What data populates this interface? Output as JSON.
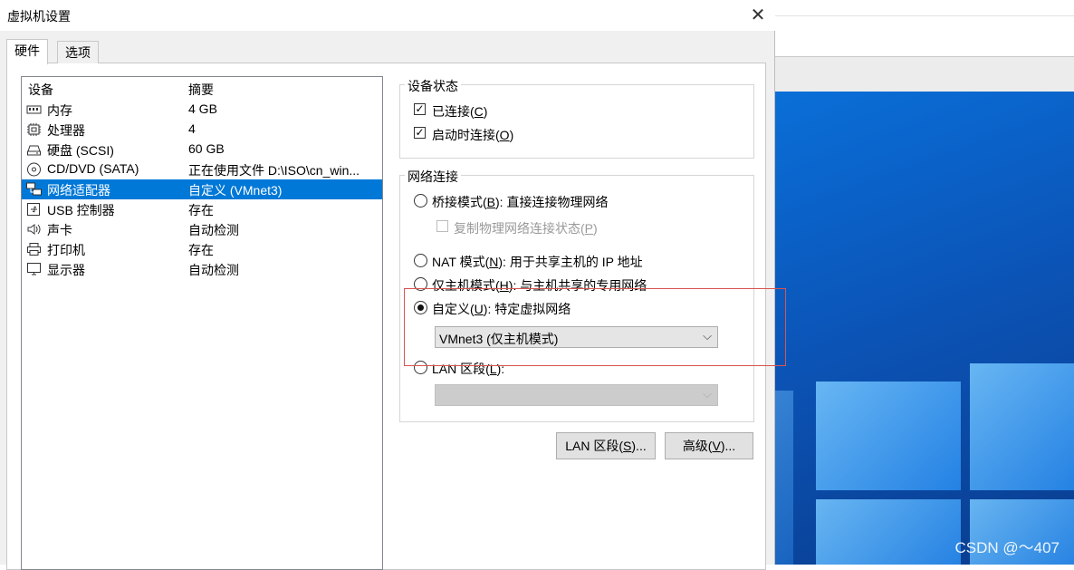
{
  "window": {
    "title": "虚拟机设置",
    "close": "✕"
  },
  "tabs": [
    {
      "label": "硬件"
    },
    {
      "label": "选项"
    }
  ],
  "device_list": {
    "columns": [
      "设备",
      "摘要"
    ],
    "rows": [
      {
        "name": "内存",
        "summary": "4 GB",
        "icon": "memory-icon"
      },
      {
        "name": "处理器",
        "summary": "4",
        "icon": "cpu-icon"
      },
      {
        "name": "硬盘 (SCSI)",
        "summary": "60 GB",
        "icon": "hard-disk-icon"
      },
      {
        "name": "CD/DVD (SATA)",
        "summary": "正在使用文件 D:\\ISO\\cn_win...",
        "icon": "cd-dvd-icon"
      },
      {
        "name": "网络适配器",
        "summary": "自定义 (VMnet3)",
        "icon": "network-adapter-icon",
        "selected": true
      },
      {
        "name": "USB 控制器",
        "summary": "存在",
        "icon": "usb-icon"
      },
      {
        "name": "声卡",
        "summary": "自动检测",
        "icon": "speaker-icon"
      },
      {
        "name": "打印机",
        "summary": "存在",
        "icon": "printer-icon"
      },
      {
        "name": "显示器",
        "summary": "自动检测",
        "icon": "monitor-icon"
      }
    ]
  },
  "device_status": {
    "title": "设备状态",
    "connected": {
      "text": "已连接(",
      "key": "C",
      "end": ")",
      "checked": true
    },
    "connect_on_start": {
      "text": "启动时连接(",
      "key": "O",
      "end": ")",
      "checked": true
    }
  },
  "network": {
    "title": "网络连接",
    "bridged": {
      "text": "桥接模式(",
      "key": "B",
      "end": "): 直接连接物理网络"
    },
    "replicate": {
      "text": "复制物理网络连接状态(",
      "key": "P",
      "end": ")"
    },
    "nat": {
      "text": "NAT 模式(",
      "key": "N",
      "end": "): 用于共享主机的 IP 地址"
    },
    "host_only": {
      "text": "仅主机模式(",
      "key": "H",
      "end": "): 与主机共享的专用网络"
    },
    "custom": {
      "text": "自定义(",
      "key": "U",
      "end": "): 特定虚拟网络",
      "selected": true
    },
    "custom_select": "VMnet3 (仅主机模式)",
    "lan": {
      "text": "LAN 区段(",
      "key": "L",
      "end": "):"
    },
    "lan_select": ""
  },
  "buttons": {
    "lan_segments": {
      "text": "LAN 区段(",
      "key": "S",
      "end": ")..."
    },
    "advanced": {
      "text": "高级(",
      "key": "V",
      "end": ")..."
    }
  },
  "watermark": "CSDN @～407",
  "colors": {
    "selection": "#0078d7",
    "highlight_box": "#d9534f",
    "desktop": "#0b55b8"
  }
}
